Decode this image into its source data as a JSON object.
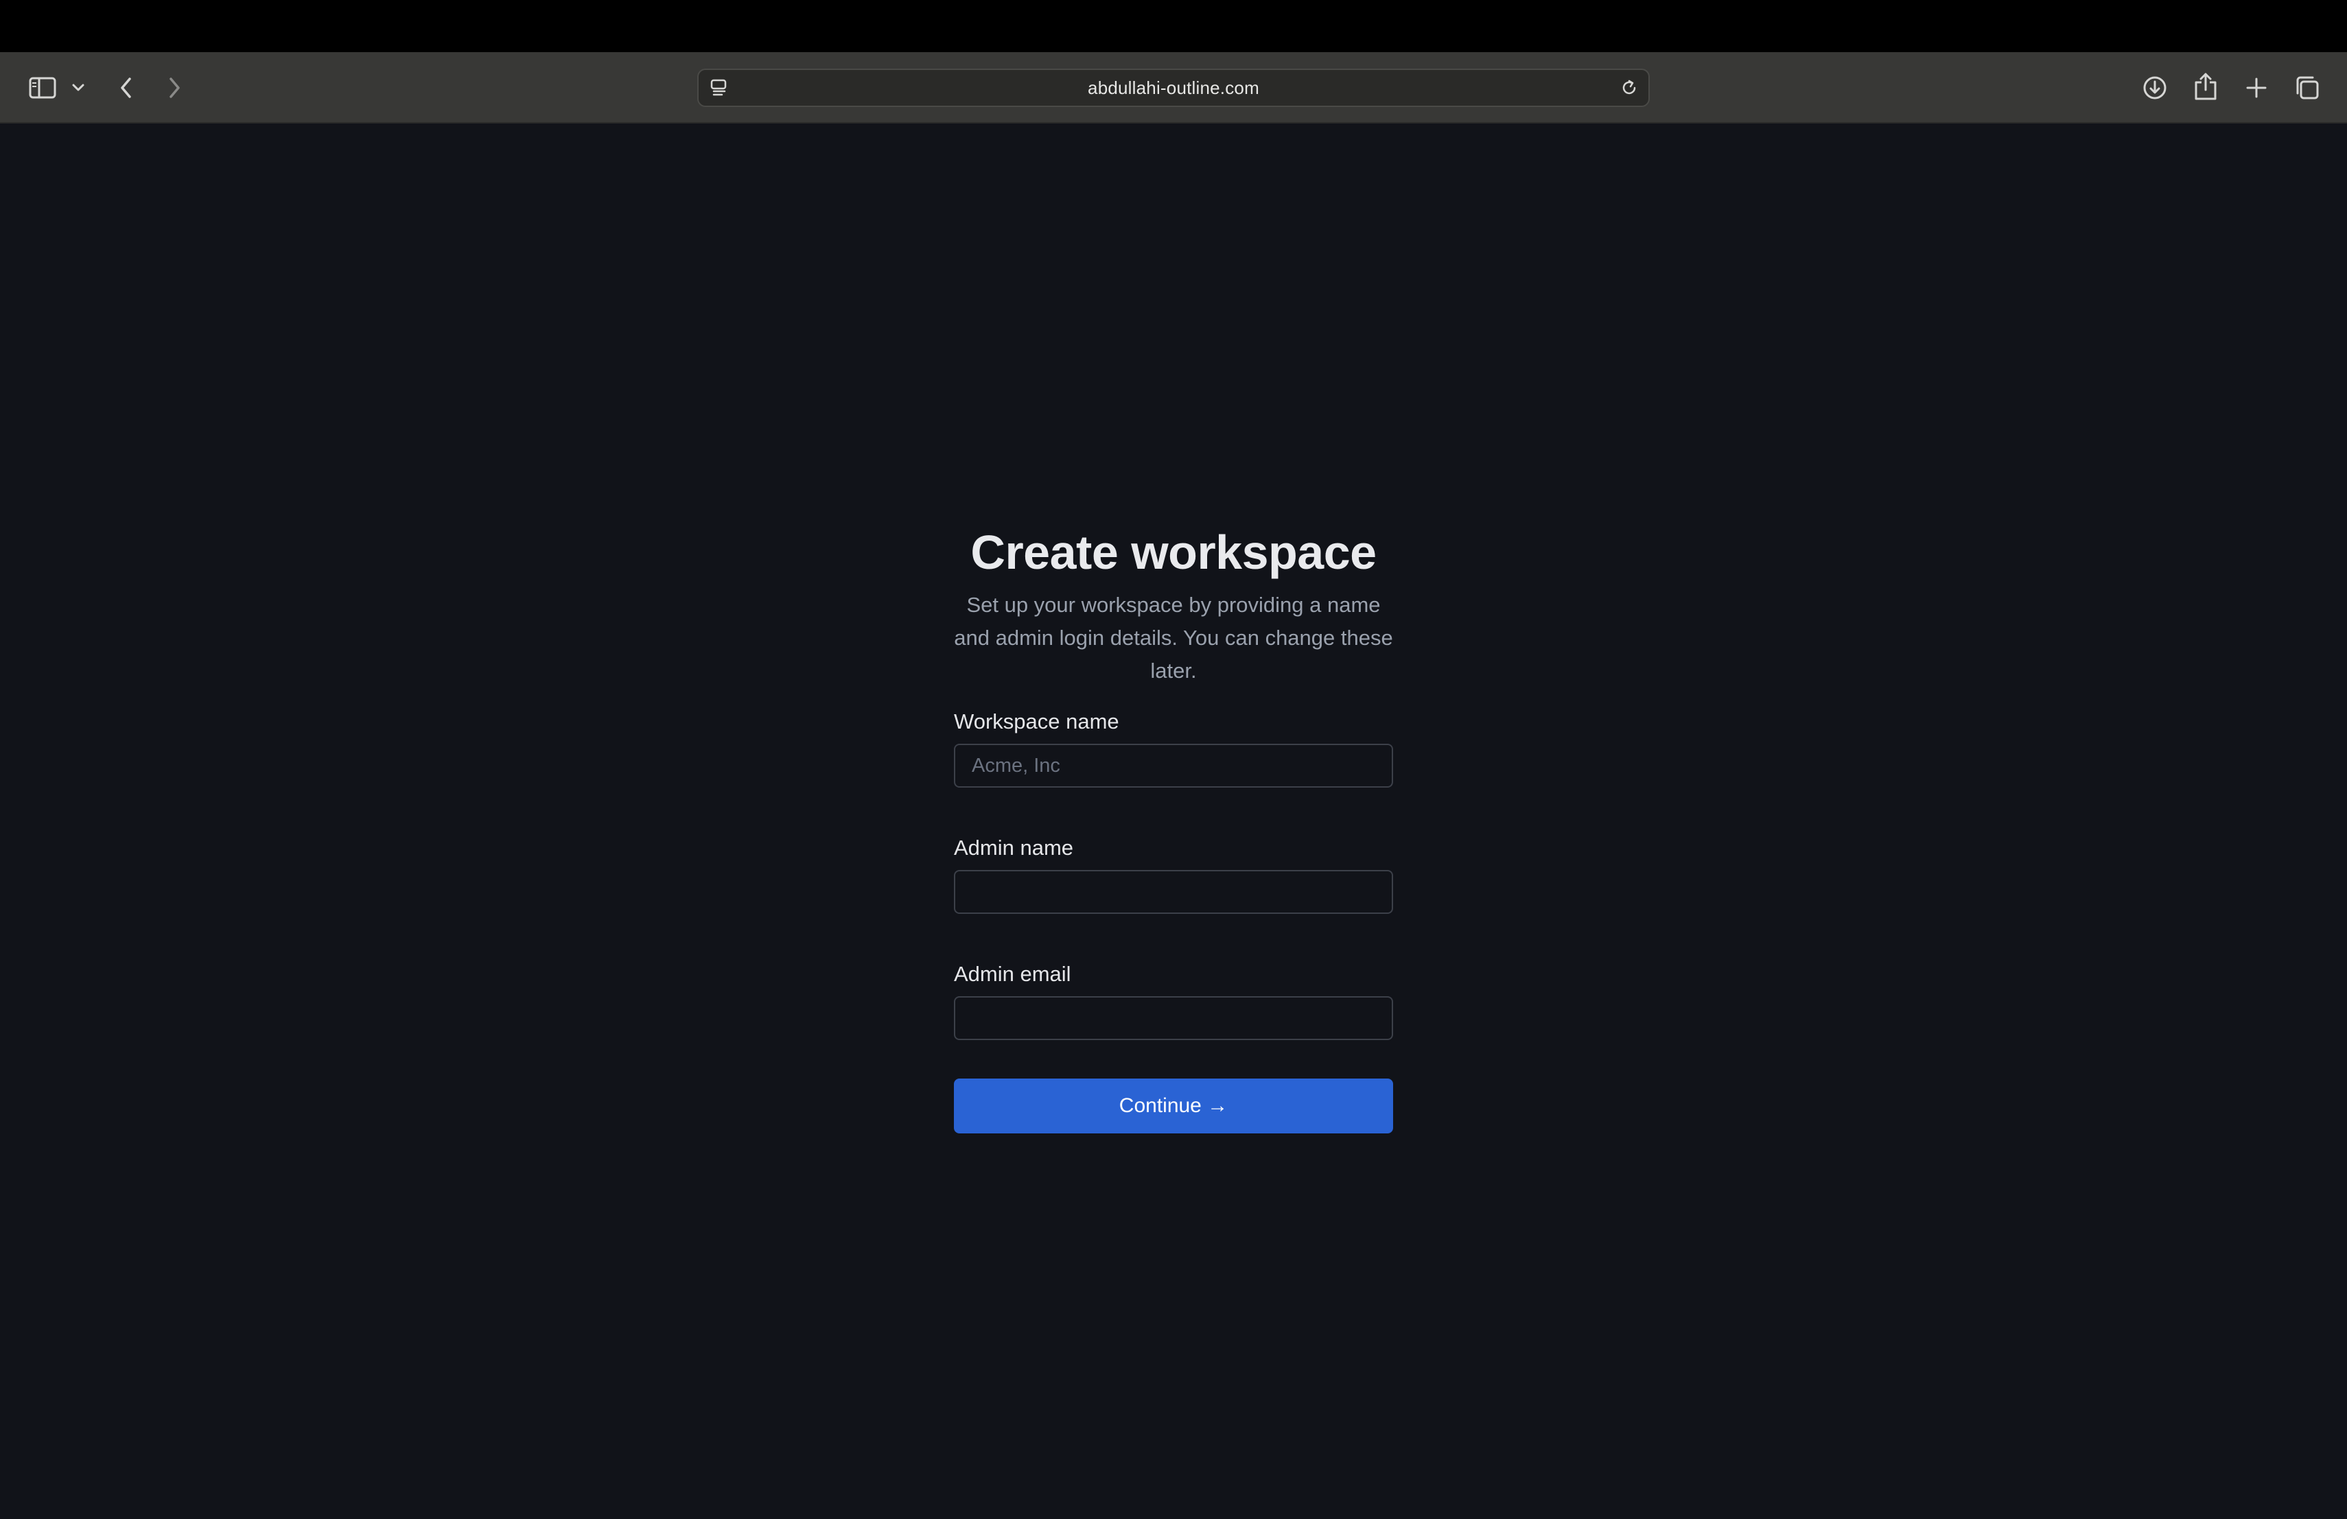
{
  "browser": {
    "url": "abdullahi-outline.com",
    "icons": {
      "sidebar": "sidebar-icon",
      "sidebar_menu": "chevron-down-icon",
      "back": "chevron-left-icon",
      "forward": "chevron-right-icon",
      "page_settings": "page-settings-icon",
      "reload": "reload-icon",
      "downloads": "download-icon",
      "share": "share-icon",
      "new_tab": "plus-icon",
      "tab_overview": "tabs-icon"
    }
  },
  "form": {
    "title": "Create workspace",
    "subtitle": "Set up your workspace by providing a name and admin login details. You can change these later.",
    "fields": [
      {
        "label": "Workspace name",
        "value": "",
        "placeholder": "Acme, Inc"
      },
      {
        "label": "Admin name",
        "value": "",
        "placeholder": ""
      },
      {
        "label": "Admin email",
        "value": "",
        "placeholder": ""
      }
    ],
    "submit_label": "Continue →"
  },
  "colors": {
    "page_background": "#111319",
    "toolbar_background": "#383836",
    "primary_button": "#2a63d4",
    "title_text": "#e9eaed",
    "muted_text": "#9aa1ad"
  }
}
